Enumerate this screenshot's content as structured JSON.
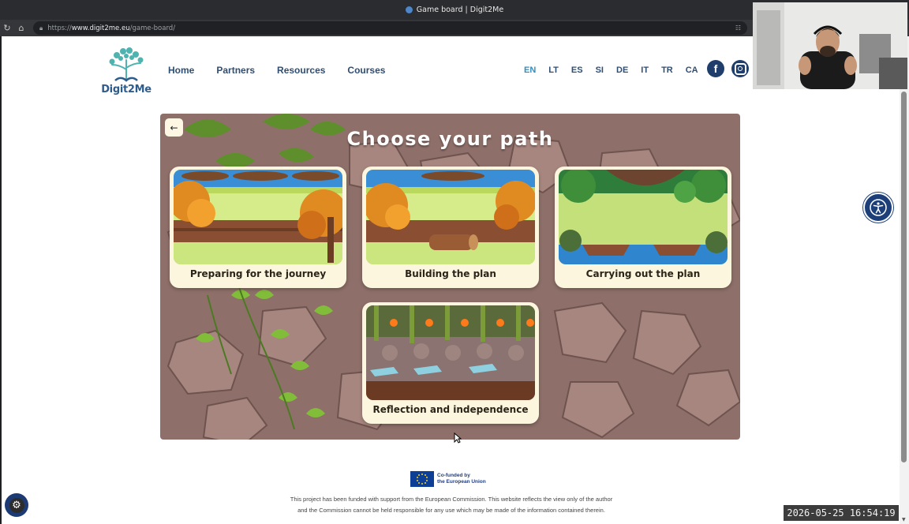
{
  "browser": {
    "tab_title": "Game board | Digit2Me",
    "url_prefix": "https://",
    "url_host": "www.digit2me.eu",
    "url_path": "/game-board/"
  },
  "header": {
    "logo_text": "Digit2Me",
    "nav": [
      "Home",
      "Partners",
      "Resources",
      "Courses"
    ],
    "languages": [
      "EN",
      "LT",
      "ES",
      "SI",
      "DE",
      "IT",
      "TR",
      "CA"
    ],
    "active_language": "EN",
    "social": {
      "facebook_letter": "f"
    }
  },
  "board": {
    "title": "Choose your path",
    "back_icon": "←",
    "paths": [
      {
        "label": "Preparing for the journey"
      },
      {
        "label": "Building the plan"
      },
      {
        "label": "Carrying out the plan"
      },
      {
        "label": "Reflection and independence"
      }
    ]
  },
  "footer": {
    "eu_line1": "Co-funded by",
    "eu_line2": "the European Union",
    "disclaimer_line1": "This project has been funded with support from the European Commission. This website reflects the view only of the author",
    "disclaimer_line2": "and the Commission cannot be held responsible for any use which may be made of the information contained therein."
  },
  "overlay": {
    "timestamp": "2026-05-25  16:54:19"
  },
  "colors": {
    "nav_text": "#2e4e74",
    "active_lang": "#2f8fc0",
    "board_rock": "#8e6f69",
    "card_bg": "#fdf6df"
  }
}
